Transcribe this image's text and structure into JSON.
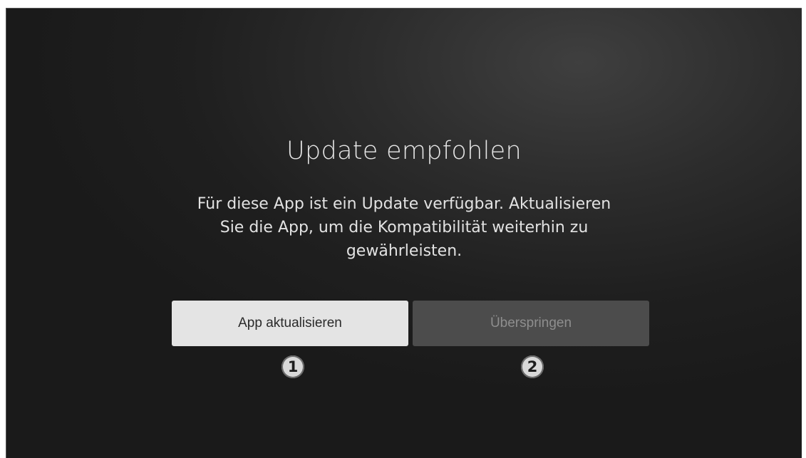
{
  "dialog": {
    "title": "Update empfohlen",
    "message_lines": [
      "Für diese App ist ein Update verfügbar. Aktualisieren",
      "Sie die App, um die Kompatibilität weiterhin zu",
      "gewährleisten."
    ]
  },
  "buttons": {
    "update_label": "App aktualisieren",
    "skip_label": "Überspringen"
  },
  "markers": [
    "1",
    "2"
  ],
  "colors": {
    "background": "#1f1f1f",
    "primary_button": "#e4e4e4",
    "secondary_button": "#4c4c4c",
    "text": "#e6e6e6"
  }
}
